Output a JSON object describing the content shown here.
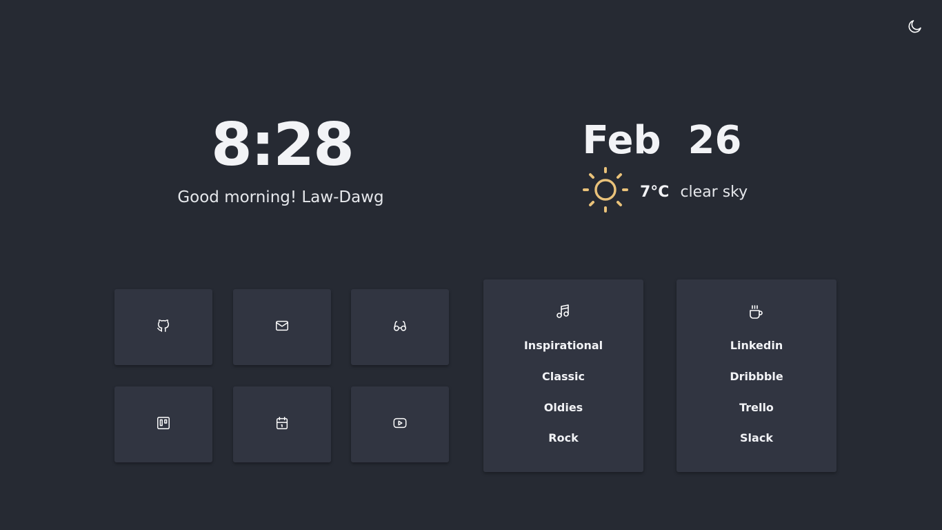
{
  "header": {
    "theme_toggle_icon": "moon-icon"
  },
  "clock": {
    "time": "8:28",
    "greeting": "Good morning! Law-Dawg"
  },
  "date": {
    "text": "Feb  26"
  },
  "weather": {
    "icon": "sun-icon",
    "icon_color": "#e9c27a",
    "temperature": "7°C",
    "description": "clear sky"
  },
  "shortcuts": [
    {
      "icon": "github-icon"
    },
    {
      "icon": "mail-icon"
    },
    {
      "icon": "glasses-icon"
    },
    {
      "icon": "trello-icon"
    },
    {
      "icon": "calendar-icon"
    },
    {
      "icon": "youtube-icon"
    }
  ],
  "music_card": {
    "icon": "music-icon",
    "items": [
      "Inspirational",
      "Classic",
      "Oldies",
      "Rock"
    ]
  },
  "work_card": {
    "icon": "coffee-icon",
    "items": [
      "Linkedin",
      "Dribbble",
      "Trello",
      "Slack"
    ]
  },
  "colors": {
    "background": "#262a33",
    "tile": "#313541",
    "text": "#f2f3f6",
    "accent_sun": "#e9c27a"
  }
}
